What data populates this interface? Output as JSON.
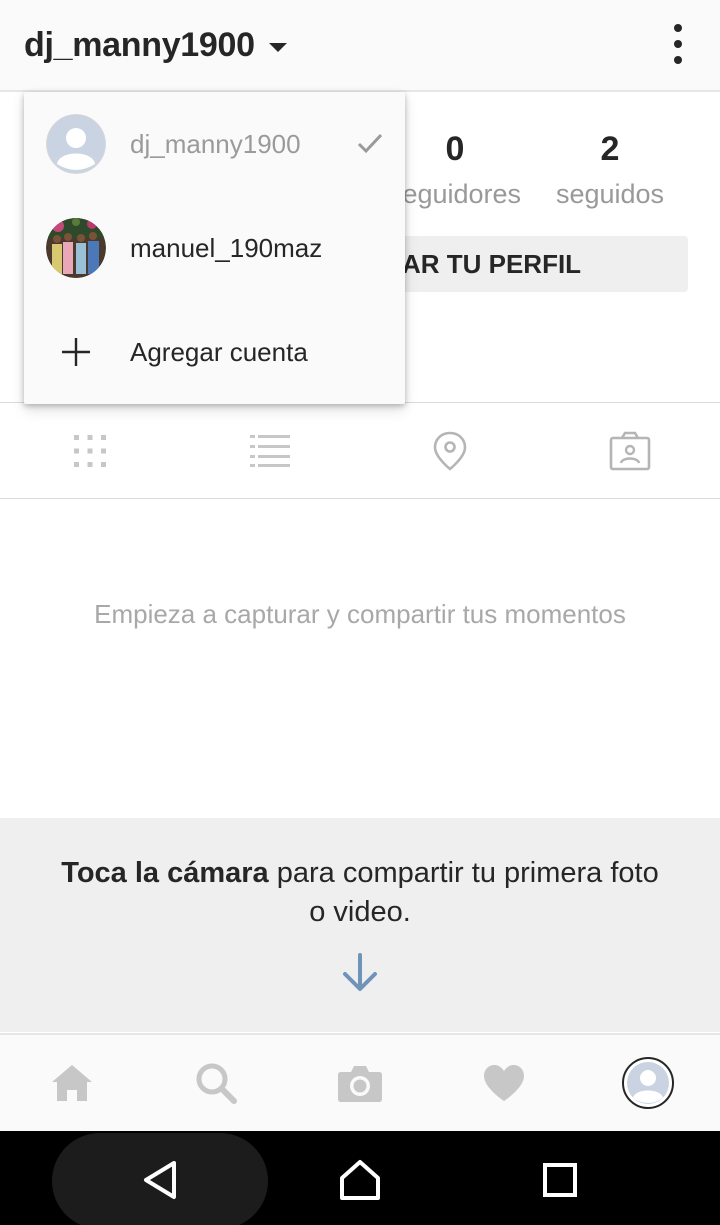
{
  "header": {
    "username": "dj_manny1900"
  },
  "profile": {
    "followers_count": "0",
    "followers_label": "seguidores",
    "following_count": "2",
    "following_label": "seguidos",
    "edit_button_visible_text": "TAR TU PERFIL"
  },
  "tabs": [
    "grid-icon",
    "list-icon",
    "location-pin-icon",
    "tagged-icon"
  ],
  "empty_state": {
    "message": "Empieza a capturar y compartir tus momentos"
  },
  "promo": {
    "bold": "Toca la cámara",
    "rest": " para compartir tu primera foto o video."
  },
  "dropdown": {
    "accounts": [
      {
        "name": "dj_manny1900",
        "active": true
      },
      {
        "name": "manuel_190maz",
        "active": false
      }
    ],
    "add_account_label": "Agregar cuenta"
  },
  "bottom_nav": [
    "home-icon",
    "search-icon",
    "camera-icon",
    "heart-icon",
    "profile-icon"
  ],
  "colors": {
    "accent_arrow": "#6f94b8",
    "muted_text": "#a8a8a8",
    "icon_gray": "#c7c7c7"
  }
}
